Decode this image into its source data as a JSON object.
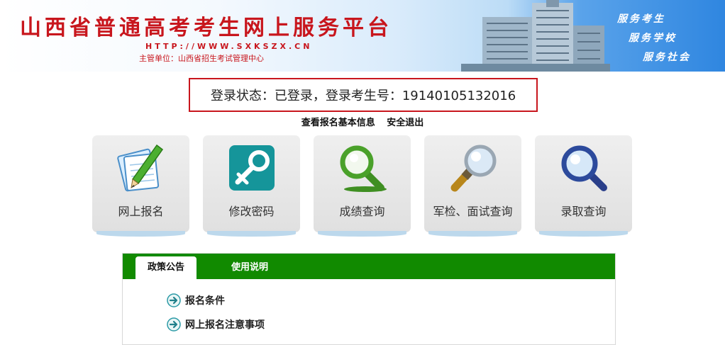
{
  "header": {
    "title": "山西省普通高考考生网上服务平台",
    "url": "HTTP://WWW.SXKSZX.CN",
    "org": "主管单位：山西省招生考试管理中心",
    "slogans": [
      "服务考生",
      "服务学校",
      "服务社会"
    ]
  },
  "status": {
    "text": "登录状态：已登录，登录考生号：19140105132016"
  },
  "links": {
    "view_info": "查看报名基本信息",
    "logout": "安全退出"
  },
  "tiles": [
    {
      "label": "网上报名",
      "icon": "notebook-pen-icon"
    },
    {
      "label": "修改密码",
      "icon": "key-icon"
    },
    {
      "label": "成绩查询",
      "icon": "green-magnifier-icon"
    },
    {
      "label": "军检、面试查询",
      "icon": "gold-magnifier-icon"
    },
    {
      "label": "录取查询",
      "icon": "blue-magnifier-icon"
    }
  ],
  "notice": {
    "tabs": [
      "政策公告",
      "使用说明"
    ],
    "items": [
      "报名条件",
      "网上报名注意事项"
    ]
  },
  "colors": {
    "brand_red": "#c8161d",
    "tab_green": "#118a00",
    "banner_blue": "#2f86e0"
  }
}
